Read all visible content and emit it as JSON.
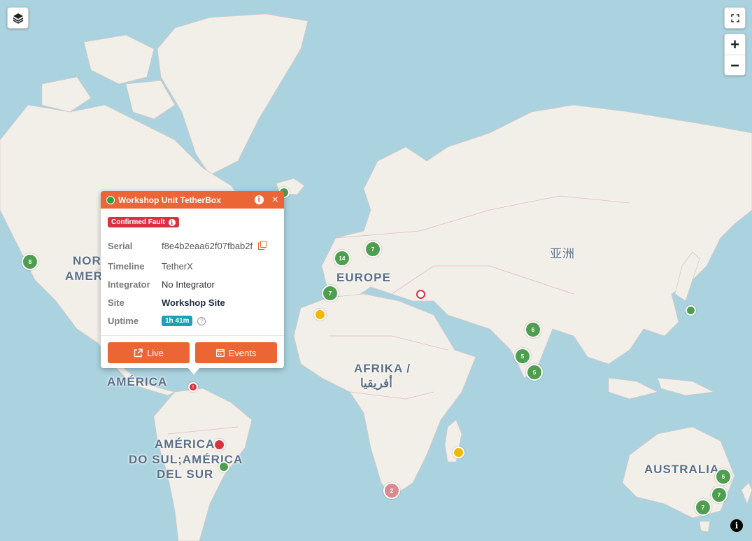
{
  "map": {
    "labels": {
      "north_america_1": "NORTH",
      "north_america_2": "AMERICA",
      "central_america": "AMÉRICA",
      "europe": "EUROPE",
      "asia": "亚洲",
      "africa_1": "AFRIKA /",
      "africa_2": "أفريقيا",
      "south_america_1": "AMÉRICA",
      "south_america_2": "DO SUL;AMÉRICA",
      "south_america_3": "DEL SUR",
      "australia": "AUSTRALIA"
    },
    "controls": {
      "zoom_in": "+",
      "zoom_out": "−",
      "layers_icon": "layers-icon",
      "fullscreen_icon": "fullscreen-icon",
      "attribution_icon": "info-icon"
    },
    "clusters": [
      {
        "count": "8",
        "status": "green"
      },
      {
        "count": "14",
        "status": "green"
      },
      {
        "count": "7",
        "status": "green"
      },
      {
        "count": "7",
        "status": "green"
      },
      {
        "count": "6",
        "status": "green"
      },
      {
        "count": "5",
        "status": "green"
      },
      {
        "count": "5",
        "status": "green"
      },
      {
        "count": "2",
        "status": "pink"
      },
      {
        "count": "6",
        "status": "green"
      },
      {
        "count": "7",
        "status": "green"
      },
      {
        "count": "7",
        "status": "green"
      },
      {
        "count": "!",
        "status": "red"
      }
    ],
    "colors": {
      "water": "#aad3df",
      "land": "#f2efe9",
      "ok": "#4e9e4f",
      "warning": "#f2b705",
      "fault": "#d9323f",
      "accent": "#ec6535"
    }
  },
  "popup": {
    "title": "Workshop Unit TetherBox",
    "status_color": "#2ea043",
    "fault_badge": "Confirmed Fault",
    "fields": {
      "serial_label": "Serial",
      "serial_value": "f8e4b2eaa62f07fbab2f",
      "timeline_label": "Timeline",
      "timeline_value": "TetherX",
      "integrator_label": "Integrator",
      "integrator_value": "No Integrator",
      "site_label": "Site",
      "site_value": "Workshop Site",
      "uptime_label": "Uptime",
      "uptime_value": "1h 41m"
    },
    "buttons": {
      "live": "Live",
      "events": "Events"
    }
  }
}
